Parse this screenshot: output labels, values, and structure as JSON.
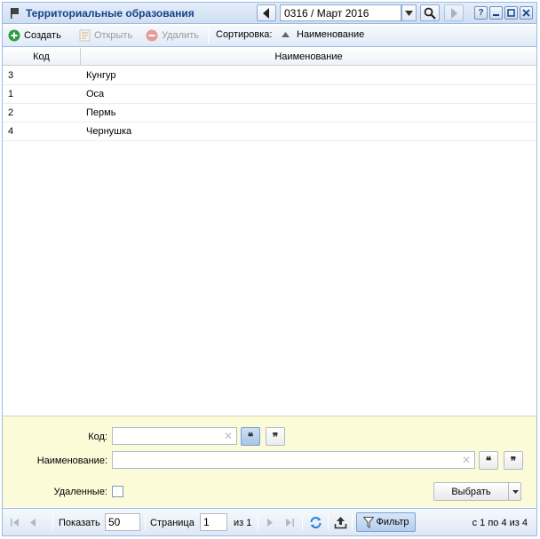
{
  "window": {
    "title": "Территориальные образования",
    "period": "0316 / Март 2016"
  },
  "toolbar": {
    "create_label": "Создать",
    "open_label": "Открыть",
    "delete_label": "Удалить",
    "sort_label": "Сортировка:",
    "sort_field": "Наименование"
  },
  "grid": {
    "columns": [
      "Код",
      "Наименование"
    ],
    "rows": [
      {
        "code": "3",
        "name": "Кунгур"
      },
      {
        "code": "1",
        "name": "Оса"
      },
      {
        "code": "2",
        "name": "Пермь"
      },
      {
        "code": "4",
        "name": "Чернушка"
      }
    ]
  },
  "filter": {
    "code_label": "Код:",
    "code_value": "",
    "name_label": "Наименование:",
    "name_value": "",
    "deleted_label": "Удаленные:",
    "deleted_checked": false,
    "select_label": "Выбрать"
  },
  "pager": {
    "show_label": "Показать",
    "page_size": "50",
    "page_label": "Страница",
    "page_value": "1",
    "of_label": "из 1",
    "filter_label": "Фильтр",
    "summary": "с 1 по 4 из 4"
  },
  "colors": {
    "title_text": "#15428b",
    "border": "#99bbe8",
    "filter_bg": "#fbfbd8",
    "create_icon": "#2e9d3f",
    "delete_icon": "#e06b6b"
  }
}
